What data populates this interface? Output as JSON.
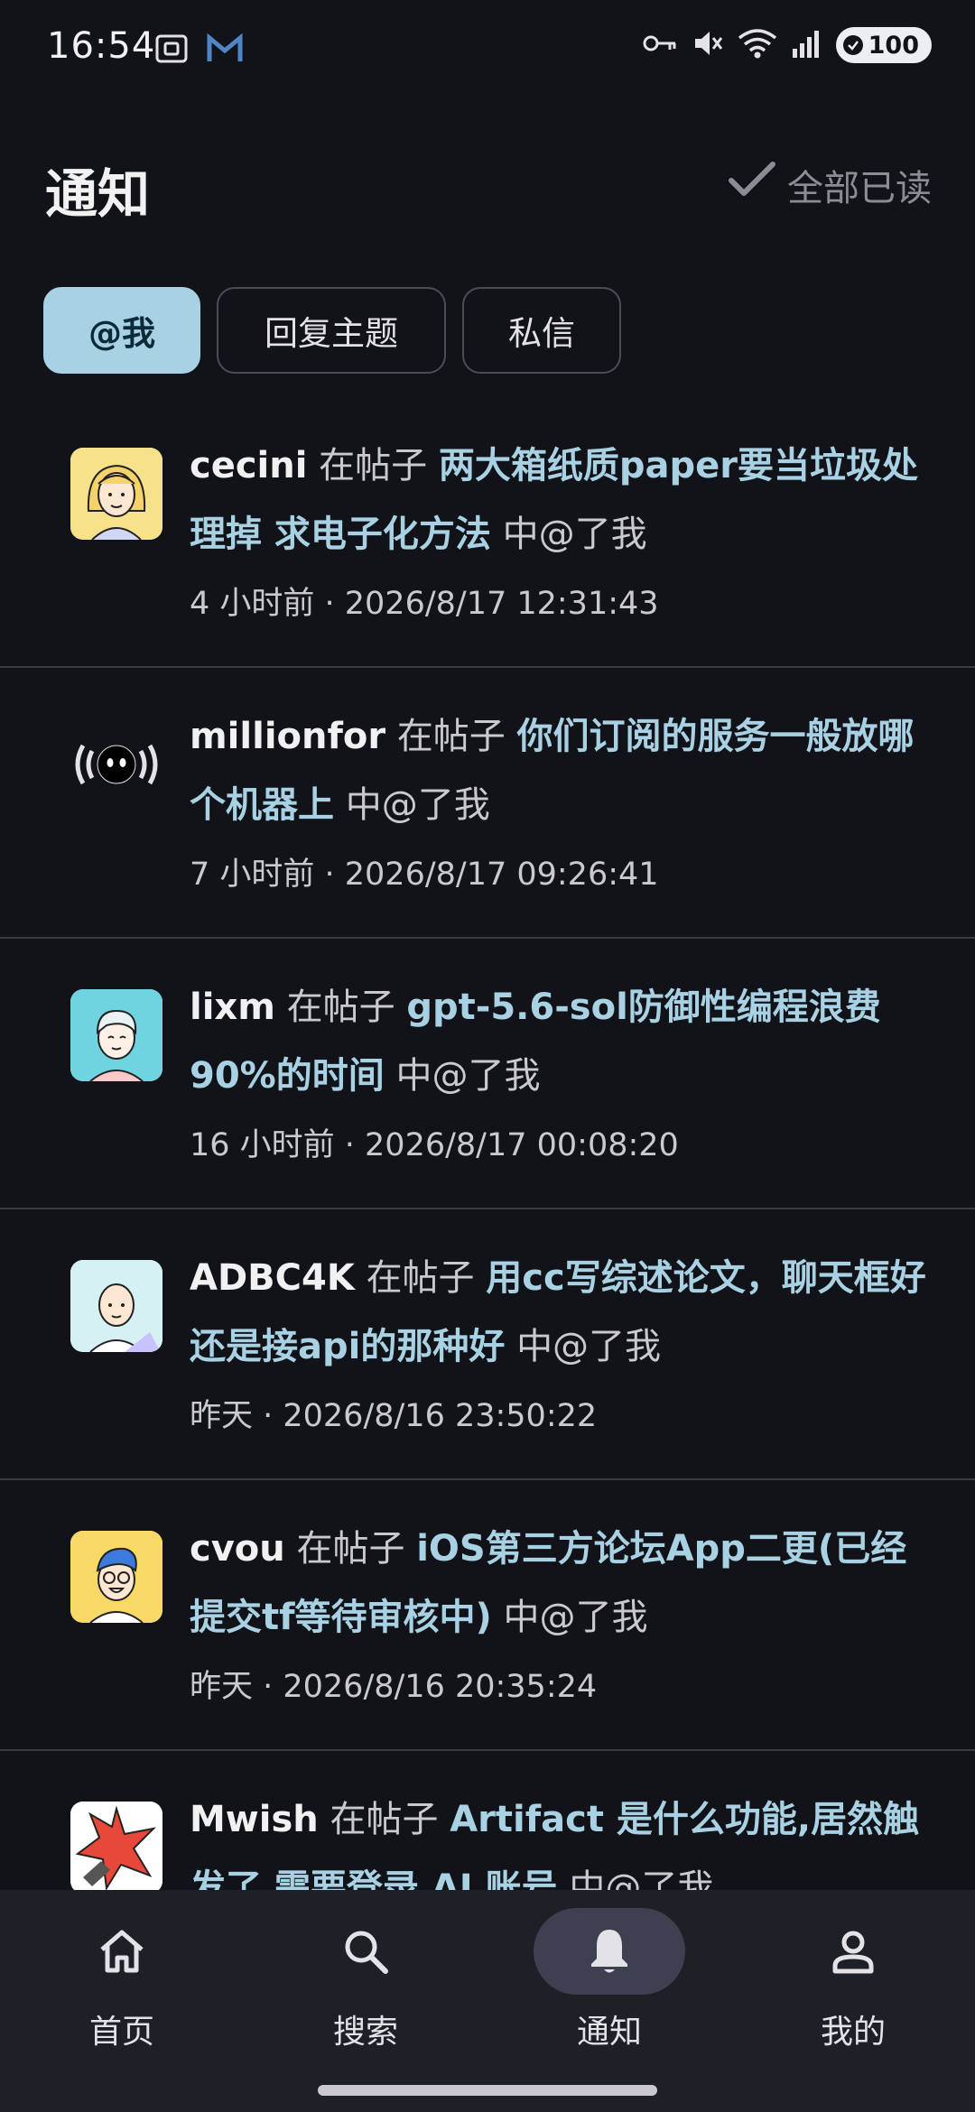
{
  "status_bar": {
    "time": "16:54",
    "battery": "100",
    "icons": [
      "screenshot-icon",
      "mail-icon",
      "key-icon",
      "mute-icon",
      "wifi-icon",
      "signal-icon"
    ]
  },
  "header": {
    "title": "通知",
    "mark_all_read": "全部已读"
  },
  "tabs": [
    {
      "label": "@我",
      "active": true
    },
    {
      "label": "回复主题",
      "active": false
    },
    {
      "label": "私信",
      "active": false
    }
  ],
  "notifications": [
    {
      "user": "cecini",
      "pre": "在帖子",
      "topic": "两大箱纸质paper要当垃圾处理掉 求电子化方法",
      "post": "中@了我",
      "meta": "4 小时前 · 2026/8/17 12:31:43",
      "avatar": "woman-blonde-avatar"
    },
    {
      "user": "millionfor",
      "pre": "在帖子",
      "topic": "你们订阅的服务一般放哪个机器上",
      "post": "中@了我",
      "meta": "7 小时前 · 2026/8/17 09:26:41",
      "avatar": "broadcast-face-avatar"
    },
    {
      "user": "lixm",
      "pre": "在帖子",
      "topic": "gpt-5.6-sol防御性编程浪费90%的时间",
      "post": "中@了我",
      "meta": "16 小时前 · 2026/8/17 00:08:20",
      "avatar": "person-teal-avatar"
    },
    {
      "user": "ADBC4K",
      "pre": "在帖子",
      "topic": "用cc写综述论文，聊天框好还是接api的那种好",
      "post": "中@了我",
      "meta": "昨天 · 2026/8/16 23:50:22",
      "avatar": "bald-man-avatar"
    },
    {
      "user": "cvou",
      "pre": "在帖子",
      "topic": "iOS第三方论坛App二更(已经提交tf等待审核中)",
      "post": "中@了我",
      "meta": "昨天 · 2026/8/16 20:35:24",
      "avatar": "glasses-man-avatar"
    },
    {
      "user": "Mwish",
      "pre": "在帖子",
      "topic": "Artifact 是什么功能,居然触发了 需要登录 AI 账号",
      "post": "中@了我",
      "meta": "",
      "avatar": "red-star-avatar"
    }
  ],
  "bottom_nav": [
    {
      "label": "首页",
      "icon": "home-icon",
      "active": false
    },
    {
      "label": "搜索",
      "icon": "search-icon",
      "active": false
    },
    {
      "label": "通知",
      "icon": "bell-icon",
      "active": true
    },
    {
      "label": "我的",
      "icon": "person-icon",
      "active": false
    }
  ],
  "colors": {
    "background": "#111318",
    "accent": "#a8d1e4",
    "nav_background": "#1d2026",
    "divider": "#3a3c42"
  }
}
